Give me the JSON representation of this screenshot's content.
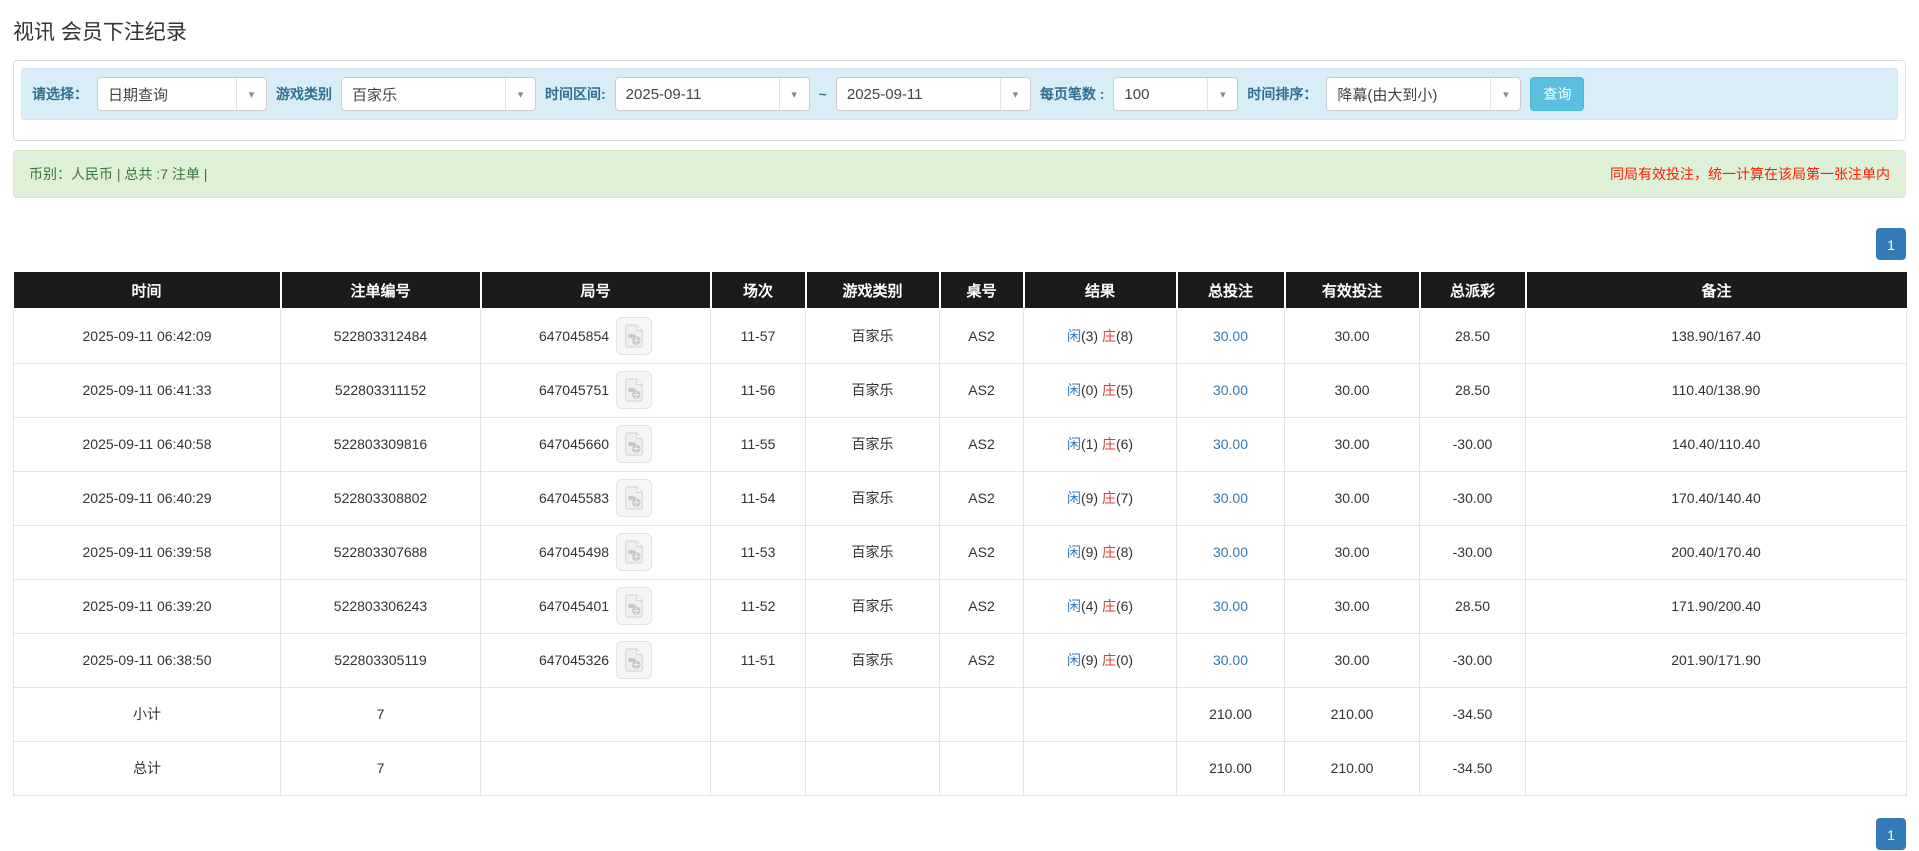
{
  "page": {
    "title": "视讯 会员下注纪录"
  },
  "filters": {
    "select_label": "请选择：",
    "select_value": "日期查询",
    "game_type_label": "游戏类别",
    "game_type_value": "百家乐",
    "date_range_label": "时间区间:",
    "date_from": "2025-09-11",
    "date_separator": "~",
    "date_to": "2025-09-11",
    "page_size_label": "每页笔数 :",
    "page_size_value": "100",
    "sort_label": "时间排序：",
    "sort_value": "降幕(由大到小)",
    "search_button": "查询"
  },
  "summary_bar": {
    "left_text": "币别：人民币 | 总共 :7 注单 |",
    "right_notice": "同局有效投注，统一计算在该局第一张注单内"
  },
  "pagination": {
    "current_page": "1"
  },
  "colors": {
    "accent_blue": "#337ab7",
    "filter_bar_bg": "#d9edf7",
    "filter_label_text": "#31708f",
    "search_button_bg": "#5bc0de",
    "summary_bar_bg": "#dff0d8",
    "summary_bar_text": "#3c763d",
    "notice_red": "#ff1a00",
    "negative_red": "#e60000",
    "banker_red": "#e4393c",
    "table_header_bg": "#1b1b1b",
    "total_row_bg": "#9d9d9d"
  },
  "table": {
    "headers": [
      "时间",
      "注单编号",
      "局号",
      "场次",
      "游戏类别",
      "桌号",
      "结果",
      "总投注",
      "有效投注",
      "总派彩",
      "备注"
    ],
    "rows": [
      {
        "time": "2025-09-11 06:42:09",
        "bet_id": "522803312484",
        "round_id": "647045854",
        "session": "11-57",
        "game": "百家乐",
        "table_no": "AS2",
        "result": {
          "player_label": "闲",
          "player_value": "(3)",
          "banker_label": "庄",
          "banker_value": "(8)"
        },
        "total_bet": "30.00",
        "valid_bet": "30.00",
        "payout": "28.50",
        "remark": "138.90/167.40"
      },
      {
        "time": "2025-09-11 06:41:33",
        "bet_id": "522803311152",
        "round_id": "647045751",
        "session": "11-56",
        "game": "百家乐",
        "table_no": "AS2",
        "result": {
          "player_label": "闲",
          "player_value": "(0)",
          "banker_label": "庄",
          "banker_value": "(5)"
        },
        "total_bet": "30.00",
        "valid_bet": "30.00",
        "payout": "28.50",
        "remark": "110.40/138.90"
      },
      {
        "time": "2025-09-11 06:40:58",
        "bet_id": "522803309816",
        "round_id": "647045660",
        "session": "11-55",
        "game": "百家乐",
        "table_no": "AS2",
        "result": {
          "player_label": "闲",
          "player_value": "(1)",
          "banker_label": "庄",
          "banker_value": "(6)"
        },
        "total_bet": "30.00",
        "valid_bet": "30.00",
        "payout": "-30.00",
        "remark": "140.40/110.40"
      },
      {
        "time": "2025-09-11 06:40:29",
        "bet_id": "522803308802",
        "round_id": "647045583",
        "session": "11-54",
        "game": "百家乐",
        "table_no": "AS2",
        "result": {
          "player_label": "闲",
          "player_value": "(9)",
          "banker_label": "庄",
          "banker_value": "(7)"
        },
        "total_bet": "30.00",
        "valid_bet": "30.00",
        "payout": "-30.00",
        "remark": "170.40/140.40"
      },
      {
        "time": "2025-09-11 06:39:58",
        "bet_id": "522803307688",
        "round_id": "647045498",
        "session": "11-53",
        "game": "百家乐",
        "table_no": "AS2",
        "result": {
          "player_label": "闲",
          "player_value": "(9)",
          "banker_label": "庄",
          "banker_value": "(8)"
        },
        "total_bet": "30.00",
        "valid_bet": "30.00",
        "payout": "-30.00",
        "remark": "200.40/170.40"
      },
      {
        "time": "2025-09-11 06:39:20",
        "bet_id": "522803306243",
        "round_id": "647045401",
        "session": "11-52",
        "game": "百家乐",
        "table_no": "AS2",
        "result": {
          "player_label": "闲",
          "player_value": "(4)",
          "banker_label": "庄",
          "banker_value": "(6)"
        },
        "total_bet": "30.00",
        "valid_bet": "30.00",
        "payout": "28.50",
        "remark": "171.90/200.40"
      },
      {
        "time": "2025-09-11 06:38:50",
        "bet_id": "522803305119",
        "round_id": "647045326",
        "session": "11-51",
        "game": "百家乐",
        "table_no": "AS2",
        "result": {
          "player_label": "闲",
          "player_value": "(9)",
          "banker_label": "庄",
          "banker_value": "(0)"
        },
        "total_bet": "30.00",
        "valid_bet": "30.00",
        "payout": "-30.00",
        "remark": "201.90/171.90"
      }
    ],
    "subtotal": {
      "label": "小计",
      "count": "7",
      "total_bet": "210.00",
      "valid_bet": "210.00",
      "payout": "-34.50",
      "remark": ""
    },
    "total": {
      "label": "总计",
      "count": "7",
      "total_bet": "210.00",
      "valid_bet": "210.00",
      "payout": "-34.50",
      "remark": ""
    }
  },
  "icons": {
    "round_video_icon": "video-file-icon",
    "select_caret_icon": "chevron-down-icon"
  }
}
